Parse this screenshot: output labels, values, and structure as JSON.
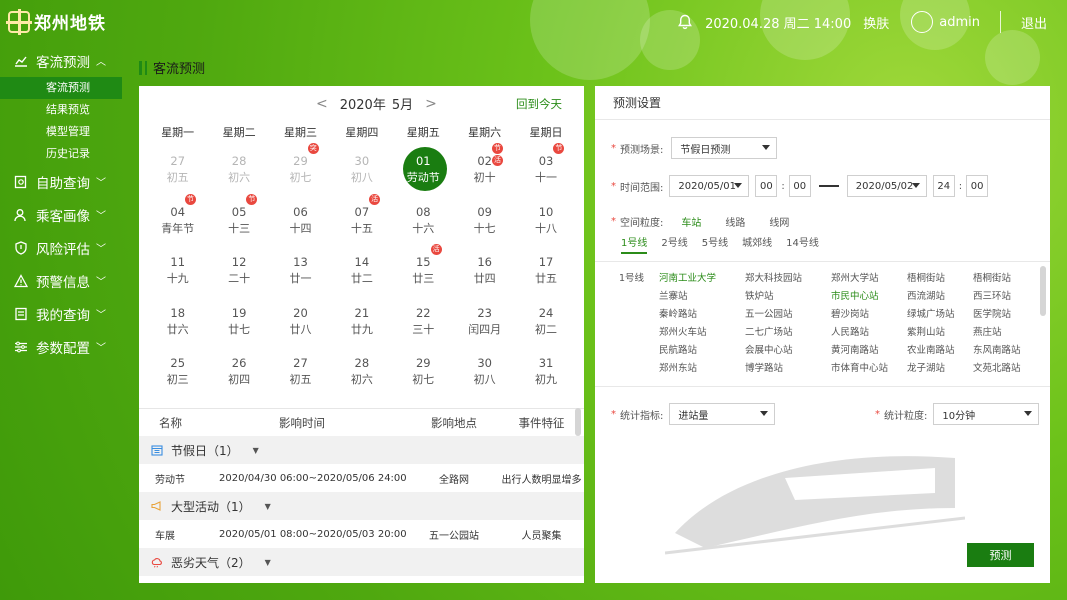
{
  "header": {
    "logo_text": "郑州地铁",
    "datetime": "2020.04.28 周二 14:00",
    "theme": "换肤",
    "user": "admin",
    "logout": "退出"
  },
  "sidebar": {
    "groups": [
      {
        "label": "客流预测",
        "icon": "chart-icon",
        "subs": [
          "客流预测",
          "结果预览",
          "模型管理",
          "历史记录"
        ]
      },
      {
        "label": "自助查询",
        "icon": "search-doc-icon"
      },
      {
        "label": "乘客画像",
        "icon": "user-icon"
      },
      {
        "label": "风险评估",
        "icon": "shield-icon"
      },
      {
        "label": "预警信息",
        "icon": "warning-icon"
      },
      {
        "label": "我的查询",
        "icon": "doc-icon"
      },
      {
        "label": "参数配置",
        "icon": "settings-icon"
      }
    ]
  },
  "panel_title": "客流预测",
  "calendar": {
    "year_label": "2020年",
    "month_label": "5月",
    "back_today": "回到今天",
    "weekdays": [
      "星期一",
      "星期二",
      "星期三",
      "星期四",
      "星期五",
      "星期六",
      "星期日"
    ],
    "weeks": [
      [
        {
          "n": "27",
          "l": "初五",
          "o": true
        },
        {
          "n": "28",
          "l": "初六",
          "o": true
        },
        {
          "n": "29",
          "l": "初七",
          "o": true,
          "b": "突"
        },
        {
          "n": "30",
          "l": "初八",
          "o": true
        },
        {
          "n": "01",
          "l": "劳动节",
          "sel": true
        },
        {
          "n": "02",
          "l": "初十",
          "b": "节",
          "b2": "活"
        },
        {
          "n": "03",
          "l": "十一",
          "b": "节"
        }
      ],
      [
        {
          "n": "04",
          "l": "青年节",
          "b": "节"
        },
        {
          "n": "05",
          "l": "十三",
          "b": "节"
        },
        {
          "n": "06",
          "l": "十四"
        },
        {
          "n": "07",
          "l": "十五",
          "b": "活"
        },
        {
          "n": "08",
          "l": "十六"
        },
        {
          "n": "09",
          "l": "十七"
        },
        {
          "n": "10",
          "l": "十八"
        }
      ],
      [
        {
          "n": "11",
          "l": "十九"
        },
        {
          "n": "12",
          "l": "二十"
        },
        {
          "n": "13",
          "l": "廿一"
        },
        {
          "n": "14",
          "l": "廿二"
        },
        {
          "n": "15",
          "l": "廿三",
          "b": "活"
        },
        {
          "n": "16",
          "l": "廿四"
        },
        {
          "n": "17",
          "l": "廿五"
        }
      ],
      [
        {
          "n": "18",
          "l": "廿六"
        },
        {
          "n": "19",
          "l": "廿七"
        },
        {
          "n": "20",
          "l": "廿八"
        },
        {
          "n": "21",
          "l": "廿九"
        },
        {
          "n": "22",
          "l": "三十"
        },
        {
          "n": "23",
          "l": "闰四月"
        },
        {
          "n": "24",
          "l": "初二"
        }
      ],
      [
        {
          "n": "25",
          "l": "初三"
        },
        {
          "n": "26",
          "l": "初四"
        },
        {
          "n": "27",
          "l": "初五"
        },
        {
          "n": "28",
          "l": "初六"
        },
        {
          "n": "29",
          "l": "初七"
        },
        {
          "n": "30",
          "l": "初八"
        },
        {
          "n": "31",
          "l": "初九"
        }
      ]
    ]
  },
  "events": {
    "headers": [
      "名称",
      "影响时间",
      "影响地点",
      "事件特征"
    ],
    "groups": [
      {
        "title": "节假日（1）",
        "icon": "calendar-icon",
        "rows": [
          [
            "劳动节",
            "2020/04/30  06:00~2020/05/06  24:00",
            "全路网",
            "出行人数明显增多"
          ]
        ]
      },
      {
        "title": "大型活动（1）",
        "icon": "megaphone-icon",
        "rows": [
          [
            "车展",
            "2020/05/01  08:00~2020/05/03  20:00",
            "五一公园站",
            "人员聚集"
          ]
        ]
      },
      {
        "title": "恶劣天气（2）",
        "icon": "weather-icon",
        "rows": []
      }
    ]
  },
  "settings": {
    "title": "预测设置",
    "scene_label": "预测场景:",
    "scene_value": "节假日预测",
    "time_label": "时间范围:",
    "start_date": "2020/05/01",
    "start_h": "00",
    "start_m": "00",
    "end_date": "2020/05/02",
    "end_h": "24",
    "end_m": "00",
    "granularity_label": "空间粒度:",
    "granularity_opts": [
      "车站",
      "线路",
      "线网"
    ],
    "line_tabs": [
      "1号线",
      "2号线",
      "5号线",
      "城郊线",
      "14号线"
    ],
    "station_line": "1号线",
    "stations": [
      {
        "t": "河南工业大学",
        "g": true
      },
      {
        "t": "郑大科技园站"
      },
      {
        "t": "郑州大学站"
      },
      {
        "t": "梧桐街站"
      },
      {
        "t": "梧桐街站"
      },
      {
        "t": "兰寨站"
      },
      {
        "t": "铁炉站"
      },
      {
        "t": "市民中心站",
        "g": true
      },
      {
        "t": "西流湖站"
      },
      {
        "t": "西三环站"
      },
      {
        "t": "秦岭路站"
      },
      {
        "t": "五一公园站"
      },
      {
        "t": "碧沙岗站"
      },
      {
        "t": "绿城广场站"
      },
      {
        "t": "医学院站"
      },
      {
        "t": "郑州火车站"
      },
      {
        "t": "二七广场站"
      },
      {
        "t": "人民路站"
      },
      {
        "t": "紫荆山站"
      },
      {
        "t": "燕庄站"
      },
      {
        "t": "民航路站"
      },
      {
        "t": "会展中心站"
      },
      {
        "t": "黄河南路站"
      },
      {
        "t": "农业南路站"
      },
      {
        "t": "东风南路站"
      },
      {
        "t": "郑州东站"
      },
      {
        "t": "博学路站"
      },
      {
        "t": "市体育中心站"
      },
      {
        "t": "龙子湖站"
      },
      {
        "t": "文苑北路站"
      }
    ],
    "metric_label": "统计指标:",
    "metric_value": "进站量",
    "tgran_label": "统计粒度:",
    "tgran_value": "10分钟",
    "predict_button": "预测"
  }
}
